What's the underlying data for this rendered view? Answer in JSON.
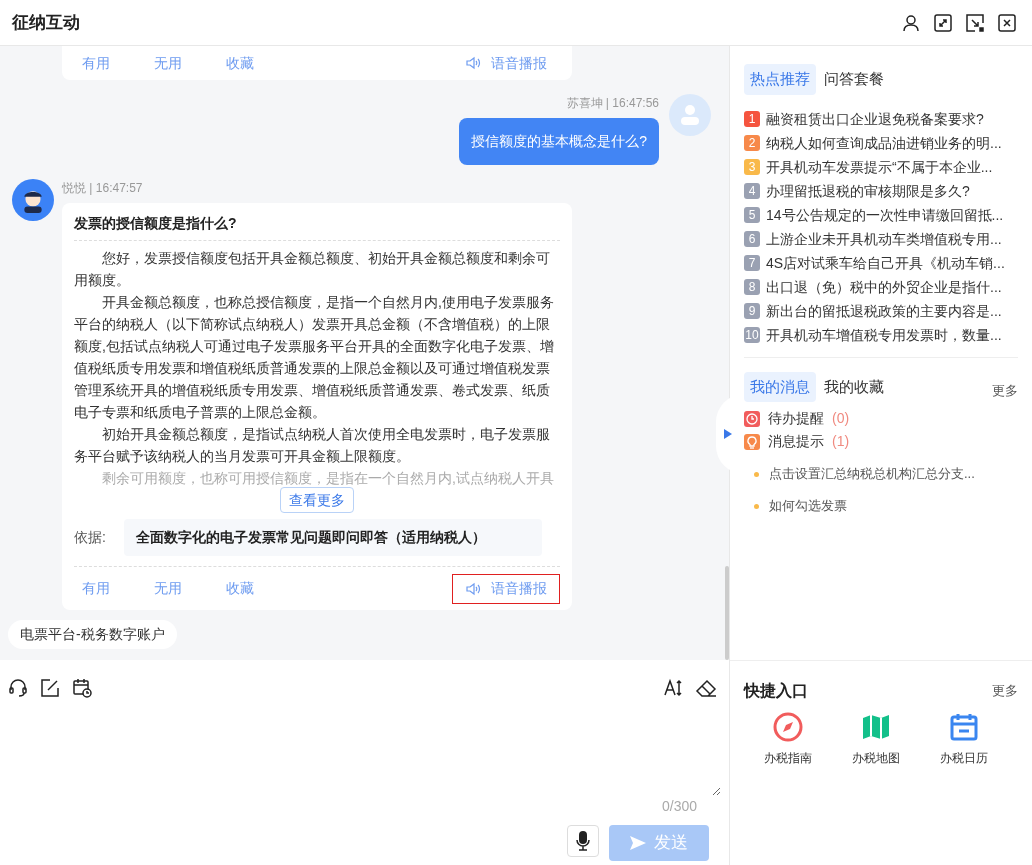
{
  "window": {
    "title": "征纳互动"
  },
  "prev_actions": [
    {
      "label": "有用",
      "kind": "text"
    },
    {
      "label": "无用",
      "kind": "text"
    },
    {
      "label": "收藏",
      "kind": "text"
    },
    {
      "label": "语音播报",
      "kind": "speak",
      "highlighted": false
    }
  ],
  "user_message": {
    "meta": "苏喜坤 | 16:47:56",
    "text": "授信额度的基本概念是什么?"
  },
  "bot_message": {
    "meta": "悦悦 | 16:47:57",
    "title": "发票的授信额度是指什么?",
    "paragraphs": [
      "您好，发票授信额度包括开具金额总额度、初始开具金额总额度和剩余可用额度。",
      "开具金额总额度，也称总授信额度，是指一个自然月内,使用电子发票服务平台的纳税人（以下简称试点纳税人）发票开具总金额（不含增值税）的上限额度,包括试点纳税人可通过电子发票服务平台开具的全面数字化电子发票、增值税纸质专用发票和增值税纸质普通发票的上限总金额以及可通过增值税发票管理系统开具的增值税纸质专用发票、增值税纸质普通发票、卷式发票、纸质电子专票和纸质电子普票的上限总金额。",
      "初始开具金额总额度，是指试点纳税人首次使用全电发票时，电子发票服务平台赋予该纳税人的当月发票可开具金额上限额度。",
      "剩余可用额度，也称可用授信额度，是指在一个自然月内,试点纳税人开具"
    ],
    "more": "查看更多",
    "basis_label": "依据:",
    "basis": "全面数字化的电子发票常见问题即问即答（适用纳税人）",
    "actions": [
      {
        "label": "有用",
        "kind": "text"
      },
      {
        "label": "无用",
        "kind": "text"
      },
      {
        "label": "收藏",
        "kind": "text"
      },
      {
        "label": "语音播报",
        "kind": "speak",
        "highlighted": true
      }
    ]
  },
  "quick_tag": "电票平台-税务数字账户",
  "input": {
    "counter": "0/300",
    "send": "发送",
    "send_disabled": true
  },
  "hot": {
    "tabs": [
      {
        "label": "热点推荐",
        "selected": true
      },
      {
        "label": "问答套餐",
        "selected": false
      }
    ],
    "items": [
      {
        "rank": "1",
        "text": "融资租赁出口企业退免税备案要求?",
        "color": "#f5543f"
      },
      {
        "rank": "2",
        "text": "纳税人如何查询成品油进销业务的明...",
        "color": "#f7894a"
      },
      {
        "rank": "3",
        "text": "开具机动车发票提示“不属于本企业...",
        "color": "#f9b94a"
      },
      {
        "rank": "4",
        "text": "办理留抵退税的审核期限是多久?",
        "color": "#9aa1b2"
      },
      {
        "rank": "5",
        "text": "14号公告规定的一次性申请缴回留抵...",
        "color": "#9aa1b2"
      },
      {
        "rank": "6",
        "text": "上游企业未开具机动车类增值税专用...",
        "color": "#9aa1b2"
      },
      {
        "rank": "7",
        "text": "4S店对试乘车给自己开具《机动车销...",
        "color": "#9aa1b2"
      },
      {
        "rank": "8",
        "text": "出口退（免）税中的外贸企业是指什...",
        "color": "#9aa1b2"
      },
      {
        "rank": "9",
        "text": "新出台的留抵退税政策的主要内容是...",
        "color": "#9aa1b2"
      },
      {
        "rank": "10",
        "text": "开具机动车增值税专用发票时，数量...",
        "color": "#9aa1b2"
      }
    ]
  },
  "messages": {
    "tabs": [
      {
        "label": "我的消息",
        "selected": true
      },
      {
        "label": "我的收藏",
        "selected": false
      }
    ],
    "more": "更多",
    "categories": [
      {
        "kind": "todo",
        "label": "待办提醒",
        "count": "(0)"
      },
      {
        "kind": "notice",
        "label": "消息提示",
        "count": "(1)"
      }
    ],
    "items": [
      "点击设置汇总纳税总机构汇总分支...",
      "如何勾选发票"
    ]
  },
  "quick": {
    "title": "快捷入口",
    "more": "更多",
    "items": [
      {
        "kind": "compass",
        "label": "办税指南"
      },
      {
        "kind": "map",
        "label": "办税地图"
      },
      {
        "kind": "calendar",
        "label": "办税日历"
      }
    ]
  }
}
